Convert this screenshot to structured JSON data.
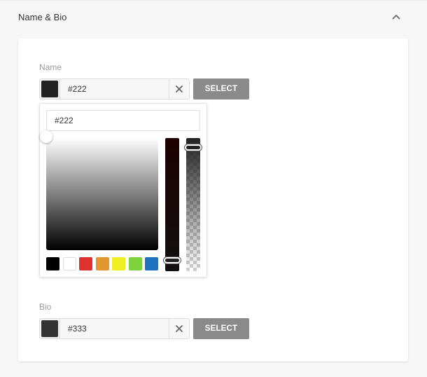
{
  "section": {
    "title": "Name & Bio",
    "toggle_icon": "chevron-up-icon"
  },
  "name_field": {
    "label": "Name",
    "value": "#222",
    "swatch_color": "#222222",
    "clear_icon": "close-icon",
    "select_label": "SELECT"
  },
  "picker": {
    "input_value": "#222",
    "presets": [
      {
        "name": "black",
        "color": "#000000"
      },
      {
        "name": "white",
        "color": "#ffffff"
      },
      {
        "name": "red",
        "color": "#e03131"
      },
      {
        "name": "orange",
        "color": "#e3972f"
      },
      {
        "name": "yellow",
        "color": "#eeee22"
      },
      {
        "name": "green",
        "color": "#7ed23c"
      },
      {
        "name": "blue",
        "color": "#1e73be"
      }
    ]
  },
  "bio_field": {
    "label": "Bio",
    "value": "#333",
    "swatch_color": "#333333",
    "clear_icon": "close-icon",
    "select_label": "SELECT"
  },
  "colors": {
    "button_bg": "#8a8a8a",
    "page_bg": "#f7f7f7",
    "card_bg": "#ffffff"
  }
}
